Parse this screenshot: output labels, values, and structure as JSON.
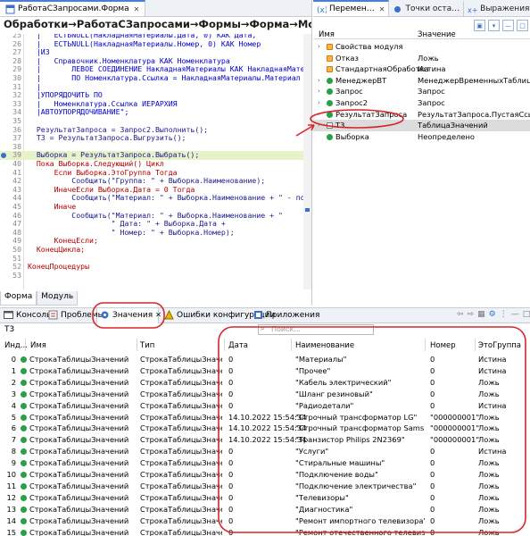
{
  "editor": {
    "tab_label": "РаботаСЗапросами.Форма",
    "breadcrumb": "Обработки→РаботаСЗапросами→Формы→Форма→Модуль",
    "bottom_tabs": [
      "Форма",
      "Модуль"
    ],
    "lines": [
      {
        "n": "25",
        "t": "  |   ЕСТЬNULL(НакладнаяМатериалы.Дата, 0) КАК Дата,"
      },
      {
        "n": "26",
        "t": "  |   ЕСТЬNULL(НакладнаяМатериалы.Номер, 0) КАК Номер"
      },
      {
        "n": "27",
        "t": "  |ИЗ"
      },
      {
        "n": "28",
        "t": "  |   Справочник.Номенклатура КАК Номенклатура"
      },
      {
        "n": "29",
        "t": "  |       ЛЕВОЕ СОЕДИНЕНИЕ НакладнаяМатериалы КАК НакладнаяМатери"
      },
      {
        "n": "30",
        "t": "  |       ПО Номенклатура.Ссылка = НакладнаяМатериалы.Материал"
      },
      {
        "n": "31",
        "t": "  |"
      },
      {
        "n": "32",
        "t": "  |УПОРЯДОЧИТЬ ПО"
      },
      {
        "n": "33",
        "t": "  |   Номенклатура.Ссылка ИЕРАРХИЯ"
      },
      {
        "n": "34",
        "t": "  |АВТОУПОРЯДОЧИВАНИЕ\";"
      },
      {
        "n": "35",
        "t": ""
      },
      {
        "n": "36",
        "t": "  РезультатЗапроса = Запрос2.Выполнить();"
      },
      {
        "n": "37",
        "t": "  Т3 = РезультатЗапроса.Выгрузить();"
      },
      {
        "n": "38",
        "t": ""
      },
      {
        "n": "39",
        "t": "  Выборка = РезультатЗапроса.Выбрать();"
      },
      {
        "n": "40",
        "t": "  Пока Выборка.Следующий() Цикл"
      },
      {
        "n": "41",
        "t": "      Если Выборка.ЭтоГруппа Тогда"
      },
      {
        "n": "42",
        "t": "          Сообщить(\"Группа: \" + Выборка.Наименование);"
      },
      {
        "n": "43",
        "t": "      ИначеЕсли Выборка.Дата = 0 Тогда"
      },
      {
        "n": "44",
        "t": "          Сообщить(\"Материал: \" + Выборка.Наименование + \" - пост"
      },
      {
        "n": "45",
        "t": "      Иначе"
      },
      {
        "n": "46",
        "t": "          Сообщить(\"Материал: \" + Выборка.Наименование + \""
      },
      {
        "n": "47",
        "t": "                   \" Дата: \" + Выборка.Дата +"
      },
      {
        "n": "48",
        "t": "                   \" Номер: \" + Выборка.Номер);"
      },
      {
        "n": "49",
        "t": "      КонецЕсли;"
      },
      {
        "n": "50",
        "t": "  КонецЦикла;"
      },
      {
        "n": "51",
        "t": ""
      },
      {
        "n": "52",
        "t": "КонецПроцедуры"
      },
      {
        "n": "53",
        "t": ""
      }
    ]
  },
  "vars": {
    "tabs": [
      "Перемен…",
      "Точки оста…",
      "Выражения"
    ],
    "col_name": "Имя",
    "col_value": "Значение",
    "rows": [
      {
        "name": "Свойства модуля",
        "value": "",
        "icon": "sq",
        "twist": "›"
      },
      {
        "name": "Отказ",
        "value": "Ложь",
        "icon": "sq",
        "twist": ""
      },
      {
        "name": "СтандартнаяОбработка",
        "value": "Истина",
        "icon": "sq",
        "twist": ""
      },
      {
        "name": "МенеджерВТ",
        "value": "МенеджерВременныхТаблиц",
        "icon": "dot",
        "twist": "›"
      },
      {
        "name": "Запрос",
        "value": "Запрос",
        "icon": "dot",
        "twist": "›"
      },
      {
        "name": "Запрос2",
        "value": "Запрос",
        "icon": "dot",
        "twist": "›"
      },
      {
        "name": "РезультатЗапроса",
        "value": "РезультатЗапроса.ПустаяСсылка",
        "icon": "dot",
        "twist": "›"
      },
      {
        "name": "Т3",
        "value": "ТаблицаЗначений",
        "icon": "tbl",
        "twist": "›"
      },
      {
        "name": "Выборка",
        "value": "Неопределено",
        "icon": "dot",
        "twist": ""
      }
    ]
  },
  "bottom": {
    "tabs": [
      "Консоль",
      "Проблемы",
      "Значения",
      "Ошибки конфигурации",
      "Приложения"
    ],
    "t3_label": "Т3",
    "search_placeholder": "Поиск...",
    "columns": [
      "Инд...",
      "Имя",
      "Тип",
      "Дата",
      "Наименование",
      "Номер",
      "ЭтоГруппа"
    ],
    "rows": [
      [
        "0",
        "СтрокаТаблицыЗначений",
        "СтрокаТаблицыЗначени",
        "0",
        "\"Материалы\"",
        "0",
        "Истина"
      ],
      [
        "1",
        "СтрокаТаблицыЗначений",
        "СтрокаТаблицыЗначени",
        "0",
        "\"Прочее\"",
        "0",
        "Истина"
      ],
      [
        "2",
        "СтрокаТаблицыЗначений",
        "СтрокаТаблицыЗначени",
        "0",
        "\"Кабель электрический\"",
        "0",
        "Ложь"
      ],
      [
        "3",
        "СтрокаТаблицыЗначений",
        "СтрокаТаблицыЗначени",
        "0",
        "\"Шланг резиновый\"",
        "0",
        "Ложь"
      ],
      [
        "4",
        "СтрокаТаблицыЗначений",
        "СтрокаТаблицыЗначени",
        "0",
        "\"Радиодетали\"",
        "0",
        "Истина"
      ],
      [
        "5",
        "СтрокаТаблицыЗначений",
        "СтрокаТаблицыЗначени",
        "14.10.2022 15:54:34",
        "\"Строчный трансформатор LG\"",
        "\"000000001\"",
        "Ложь"
      ],
      [
        "6",
        "СтрокаТаблицыЗначений",
        "СтрокаТаблицыЗначени",
        "14.10.2022 15:54:34",
        "\"Строчный трансформатор Samsung\"",
        "\"000000001\"",
        "Ложь"
      ],
      [
        "7",
        "СтрокаТаблицыЗначений",
        "СтрокаТаблицыЗначени",
        "14.10.2022 15:54:34",
        "\"Транзистор Philips 2N2369\"",
        "\"000000001\"",
        "Ложь"
      ],
      [
        "8",
        "СтрокаТаблицыЗначений",
        "СтрокаТаблицыЗначени",
        "0",
        "\"Услуги\"",
        "0",
        "Истина"
      ],
      [
        "9",
        "СтрокаТаблицыЗначений",
        "СтрокаТаблицыЗначени",
        "0",
        "\"Стиральные машины\"",
        "0",
        "Ложь"
      ],
      [
        "10",
        "СтрокаТаблицыЗначений",
        "СтрокаТаблицыЗначени",
        "0",
        "\"Подключение воды\"",
        "0",
        "Ложь"
      ],
      [
        "11",
        "СтрокаТаблицыЗначений",
        "СтрокаТаблицыЗначени",
        "0",
        "\"Подключение электричества\"",
        "0",
        "Ложь"
      ],
      [
        "12",
        "СтрокаТаблицыЗначений",
        "СтрокаТаблицыЗначени",
        "0",
        "\"Телевизоры\"",
        "0",
        "Ложь"
      ],
      [
        "13",
        "СтрокаТаблицыЗначений",
        "СтрокаТаблицыЗначени",
        "0",
        "\"Диагностика\"",
        "0",
        "Ложь"
      ],
      [
        "14",
        "СтрокаТаблицыЗначений",
        "СтрокаТаблицыЗначени",
        "0",
        "\"Ремонт импортного телевизора\"",
        "0",
        "Ложь"
      ],
      [
        "15",
        "СтрокаТаблицыЗначений",
        "СтрокаТаблицыЗначени",
        "0",
        "\"Ремонт отечественного телевизора\"",
        "0",
        "Ложь"
      ]
    ]
  },
  "colors": {
    "accent": "#3a6fcf",
    "annotation_red": "#d7262b",
    "highlight_line": "#e8f2c8"
  }
}
